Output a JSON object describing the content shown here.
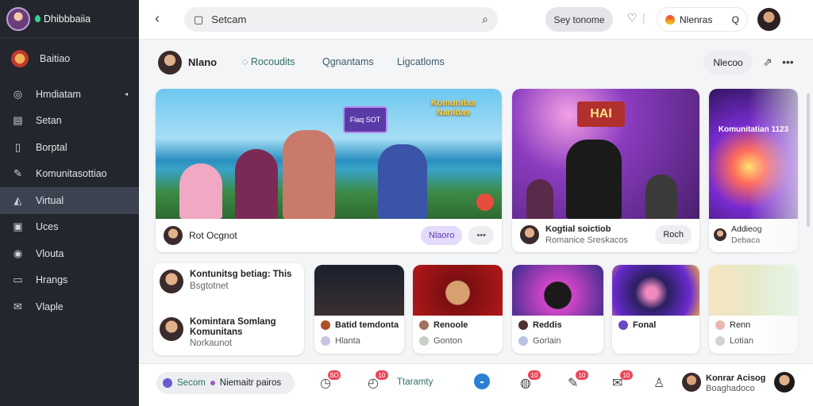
{
  "sidebar": {
    "title": "Dhibbbaiia",
    "items": [
      {
        "label": "Baitiao",
        "icon": "badge-icon"
      },
      {
        "label": "Hmdiatam",
        "icon": "compass-icon",
        "caret": "◂"
      },
      {
        "label": "Setan",
        "icon": "grid-icon"
      },
      {
        "label": "Borptal",
        "icon": "page-icon"
      },
      {
        "label": "Komunitasottiao",
        "icon": "pen-icon"
      },
      {
        "label": "Virtual",
        "icon": "triangle-icon"
      },
      {
        "label": "Uces",
        "icon": "bag-icon"
      },
      {
        "label": "Vlouta",
        "icon": "ring-icon"
      },
      {
        "label": "Hrangs",
        "icon": "screen-icon"
      },
      {
        "label": "Vlaple",
        "icon": "mail-icon"
      }
    ]
  },
  "topbar": {
    "search_placeholder": "Setcam",
    "primary_button": "Sey tonome",
    "chip_label": "Nlenras",
    "chip_search": "Q"
  },
  "subbar": {
    "name": "Nlano",
    "tabs": [
      "Rocoudits",
      "Qgnantams",
      "Ligcatloms"
    ],
    "button": "Nlecoo"
  },
  "featured": [
    {
      "title_art": "Komunitas Nanidas",
      "sign": "Fiaq SOT",
      "footer_name": "Rot Ocgnot",
      "tag1": "Nlaoro",
      "tag2": "•••"
    },
    {
      "title_art": "HAI",
      "footer_name": "Kogtial soictiob",
      "footer_sub": "Romanice Sreskacos",
      "tag": "Roch"
    },
    {
      "title_art": "Komunitatian 1123",
      "footer_name": "Addieog",
      "footer_sub": "Debaca"
    }
  ],
  "list": [
    {
      "title": "Kontunitsg betiag: This",
      "sub": "Bsgtotnet"
    },
    {
      "title": "Komintara Somlang Komunitans",
      "sub": "Norkaunot"
    }
  ],
  "small_cards": [
    {
      "line1": "Batid temdonta",
      "line2": "Hlanta"
    },
    {
      "line1": "Renoole",
      "line2": "Gonton"
    },
    {
      "line1": "Reddis",
      "line2": "Gorlain"
    },
    {
      "line1": "Fonal",
      "line2": ""
    },
    {
      "line1": "Renn",
      "line2": "Lotian"
    }
  ],
  "bottombar": {
    "pill_a": "Secom",
    "pill_b": "Niemaitr pairos",
    "center_label": "Ttaramty",
    "badges": [
      "SO",
      "10",
      "10",
      "10",
      "10"
    ],
    "user_name": "Konrar Acisog",
    "user_sub": "Boaghadoco"
  },
  "colors": {
    "sidebar_bg": "#23262c",
    "active_item": "#3c4250",
    "accent_teal": "#2c6f6a",
    "badge_red": "#e9485a"
  }
}
